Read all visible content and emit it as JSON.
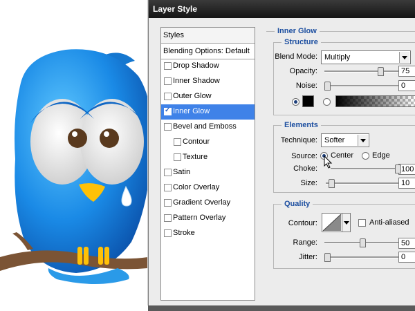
{
  "dialog": {
    "title": "Layer Style"
  },
  "styles_panel": {
    "header": "Styles",
    "blending_options": "Blending Options: Default",
    "items": [
      {
        "label": "Drop Shadow",
        "checked": false,
        "selected": false,
        "indent": false
      },
      {
        "label": "Inner Shadow",
        "checked": false,
        "selected": false,
        "indent": false
      },
      {
        "label": "Outer Glow",
        "checked": false,
        "selected": false,
        "indent": false
      },
      {
        "label": "Inner Glow",
        "checked": true,
        "selected": true,
        "indent": false
      },
      {
        "label": "Bevel and Emboss",
        "checked": false,
        "selected": false,
        "indent": false
      },
      {
        "label": "Contour",
        "checked": false,
        "selected": false,
        "indent": true
      },
      {
        "label": "Texture",
        "checked": false,
        "selected": false,
        "indent": true
      },
      {
        "label": "Satin",
        "checked": false,
        "selected": false,
        "indent": false
      },
      {
        "label": "Color Overlay",
        "checked": false,
        "selected": false,
        "indent": false
      },
      {
        "label": "Gradient Overlay",
        "checked": false,
        "selected": false,
        "indent": false
      },
      {
        "label": "Pattern Overlay",
        "checked": false,
        "selected": false,
        "indent": false
      },
      {
        "label": "Stroke",
        "checked": false,
        "selected": false,
        "indent": false
      }
    ]
  },
  "inner_glow": {
    "title": "Inner Glow",
    "structure": {
      "title": "Structure",
      "blend_mode_label": "Blend Mode:",
      "blend_mode_value": "Multiply",
      "opacity_label": "Opacity:",
      "opacity_value": "75",
      "opacity_fraction": 0.75,
      "noise_label": "Noise:",
      "noise_value": "0",
      "noise_fraction": 0,
      "glow_color": "#000000"
    },
    "elements": {
      "title": "Elements",
      "technique_label": "Technique:",
      "technique_value": "Softer",
      "source_label": "Source:",
      "source_center": "Center",
      "source_edge": "Edge",
      "source_selected": "Center",
      "choke_label": "Choke:",
      "choke_value": "100",
      "choke_fraction": 1.0,
      "size_label": "Size:",
      "size_value": "10",
      "size_fraction": 0.04
    },
    "quality": {
      "title": "Quality",
      "contour_label": "Contour:",
      "anti_aliased_label": "Anti-aliased",
      "anti_aliased_checked": false,
      "range_label": "Range:",
      "range_value": "50",
      "range_fraction": 0.5,
      "jitter_label": "Jitter:",
      "jitter_value": "0",
      "jitter_fraction": 0
    }
  },
  "colors": {
    "accent_blue": "#3f82e8",
    "section_title": "#1d4fa0",
    "bird_blue": "#1a8ae6",
    "branch_brown": "#7b5435",
    "beak_yellow": "#ffc107"
  }
}
